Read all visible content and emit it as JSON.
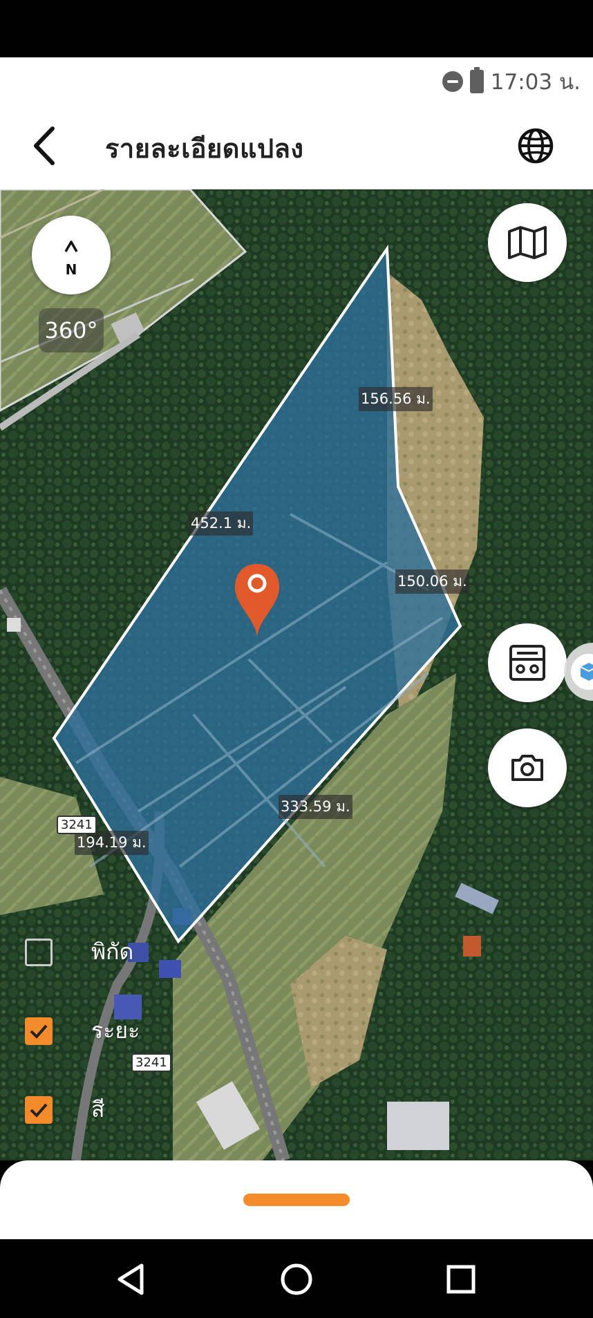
{
  "status_bar": {
    "time": "17:03 น.",
    "icons": [
      "do-not-disturb-icon",
      "battery-charging-icon"
    ]
  },
  "app_bar": {
    "title": "รายละเอียดแปลง",
    "back_icon": "chevron-left-icon",
    "language_icon": "globe-icon"
  },
  "map": {
    "compass": {
      "label": "N",
      "icon": "compass-arrow-icon"
    },
    "rotation": "360°",
    "parcel_color": "#2d6f9a",
    "marker_color": "#e2592a",
    "distance_labels": [
      "156.56 ม.",
      "452.1 ม.",
      "150.06 ม.",
      "333.59 ม.",
      "194.19 ม."
    ],
    "road_labels": [
      "3241",
      "3241"
    ]
  },
  "controls": {
    "map_type_icon": "map-icon",
    "calculator_icon": "calculator-icon",
    "camera_icon": "camera-icon",
    "side_icon": "3d-box-icon"
  },
  "layers": [
    {
      "label": "พิกัด",
      "checked": false
    },
    {
      "label": "ระยะ",
      "checked": true
    },
    {
      "label": "สี",
      "checked": true
    }
  ],
  "accent_color": "#f38b2a",
  "nav": {
    "back_icon": "triangle-back-icon",
    "home_icon": "circle-home-icon",
    "recents_icon": "square-recents-icon"
  }
}
